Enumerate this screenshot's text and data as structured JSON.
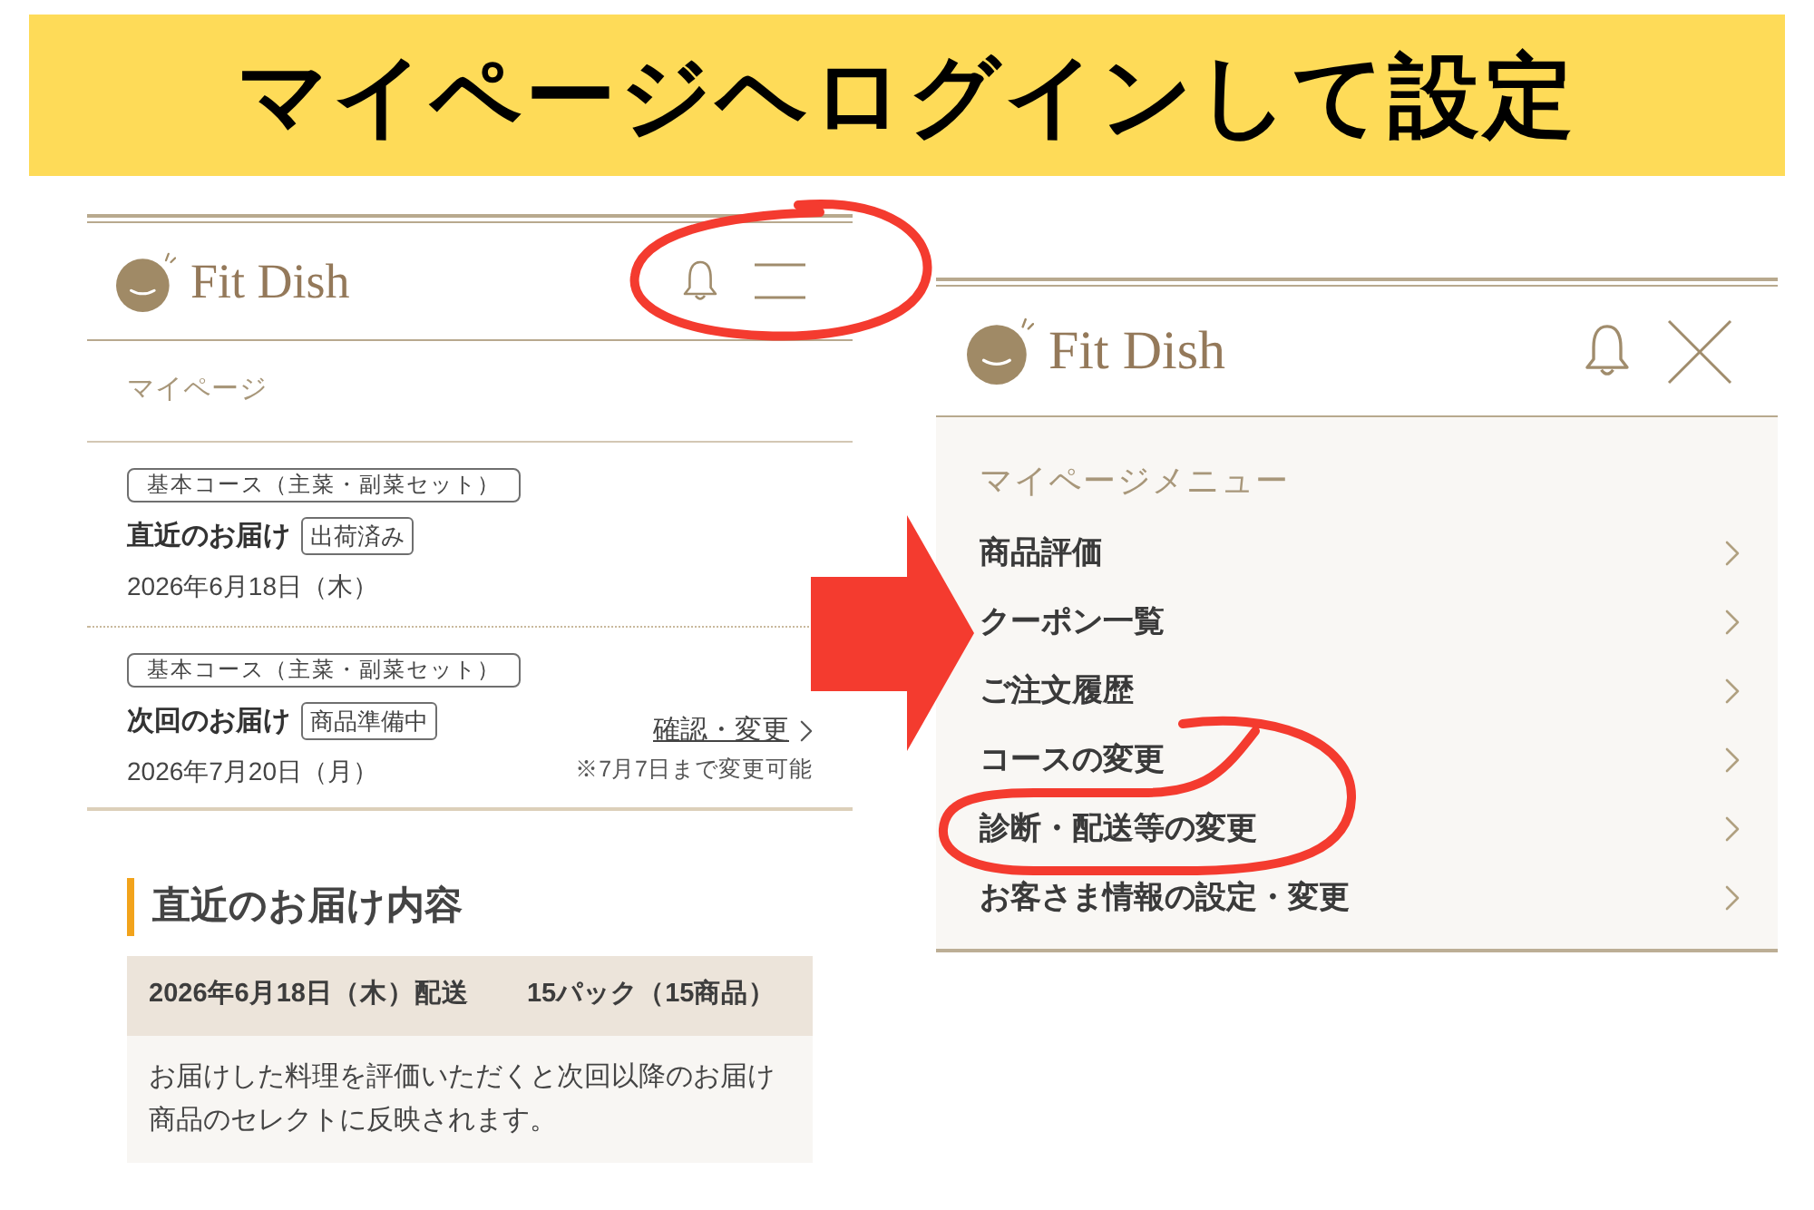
{
  "banner": {
    "title": "マイページヘログインして設定"
  },
  "mypage_screen": {
    "header": {
      "logo": "Fit Dish"
    },
    "page_title": "マイページ",
    "deliveries": [
      {
        "course": "基本コース（主菜・副菜セット）",
        "label": "直近のお届け",
        "status": "出荷済み",
        "date": "2026年6月18日（木）"
      },
      {
        "course": "基本コース（主菜・副菜セット）",
        "label": "次回のお届け",
        "status": "商品準備中",
        "date": "2026年7月20日（月）",
        "link": "確認・変更",
        "note": "※7月7日まで変更可能"
      }
    ],
    "recent_delivery": {
      "heading": "直近のお届け内容",
      "date": "2026年6月18日（木）配送",
      "count": "15パック（15商品）",
      "message": "お届けした料理を評価いただくと次回以降のお届け商品のセレクトに反映されます。"
    }
  },
  "menu_screen": {
    "header": {
      "logo": "Fit Dish"
    },
    "menu": {
      "title": "マイページメニュー",
      "items": [
        "商品評価",
        "クーポン一覧",
        "ご注文履歴",
        "コースの変更",
        "診断・配送等の変更",
        "お客さま情報の設定・変更"
      ]
    }
  }
}
